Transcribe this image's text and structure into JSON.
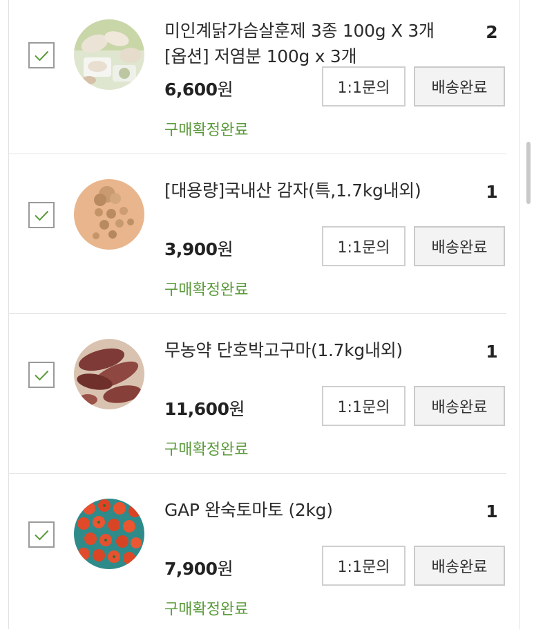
{
  "colors": {
    "check": "#5a9a3a",
    "status": "#5a9a3a",
    "border": "#cfcfcf"
  },
  "orders": [
    {
      "title_line1": "미인계닭가슴살훈제 3종 100g X 3개",
      "title_line2": "[옵션] 저염분 100g x 3개",
      "quantity": "2",
      "price": "6,600",
      "currency": "원",
      "inquiry_label": "1:1문의",
      "delivery_label": "배송완료",
      "status": "구매확정완료",
      "checked": true,
      "image_icon": "chicken-breast-photo"
    },
    {
      "title_line1": "[대용량]국내산 감자(특,1.7kg내외)",
      "title_line2": "",
      "quantity": "1",
      "price": "3,900",
      "currency": "원",
      "inquiry_label": "1:1문의",
      "delivery_label": "배송완료",
      "status": "구매확정완료",
      "checked": true,
      "image_icon": "potato-photo"
    },
    {
      "title_line1": "무농약 단호박고구마(1.7kg내외)",
      "title_line2": "",
      "quantity": "1",
      "price": "11,600",
      "currency": "원",
      "inquiry_label": "1:1문의",
      "delivery_label": "배송완료",
      "status": "구매확정완료",
      "checked": true,
      "image_icon": "sweet-potato-photo"
    },
    {
      "title_line1": "GAP 완숙토마토 (2kg)",
      "title_line2": "",
      "quantity": "1",
      "price": "7,900",
      "currency": "원",
      "inquiry_label": "1:1문의",
      "delivery_label": "배송완료",
      "status": "구매확정완료",
      "checked": true,
      "image_icon": "tomato-photo"
    }
  ]
}
